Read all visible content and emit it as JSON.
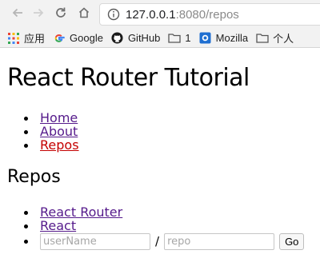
{
  "browser": {
    "url_host": "127.0.0.1",
    "url_rest": ":8080/repos",
    "bookmarks": [
      {
        "label": "应用",
        "icon": "apps-grid-icon"
      },
      {
        "label": "Google",
        "icon": "google-g-icon"
      },
      {
        "label": "GitHub",
        "icon": "github-icon"
      },
      {
        "label": "1",
        "icon": "folder-icon"
      },
      {
        "label": "Mozilla",
        "icon": "mozilla-icon"
      },
      {
        "label": "个人",
        "icon": "folder-icon"
      }
    ]
  },
  "page": {
    "title": "React Router Tutorial",
    "nav": [
      "Home",
      "About",
      "Repos"
    ],
    "active_nav": "Repos",
    "section_title": "Repos",
    "repos": [
      "React Router",
      "React"
    ],
    "form": {
      "username_placeholder": "userName",
      "separator": "/",
      "repo_placeholder": "repo",
      "submit_label": "Go"
    }
  },
  "colors": {
    "link": "#551a8b",
    "active_link": "#c40000",
    "chrome_bg": "#f2f2f2"
  }
}
